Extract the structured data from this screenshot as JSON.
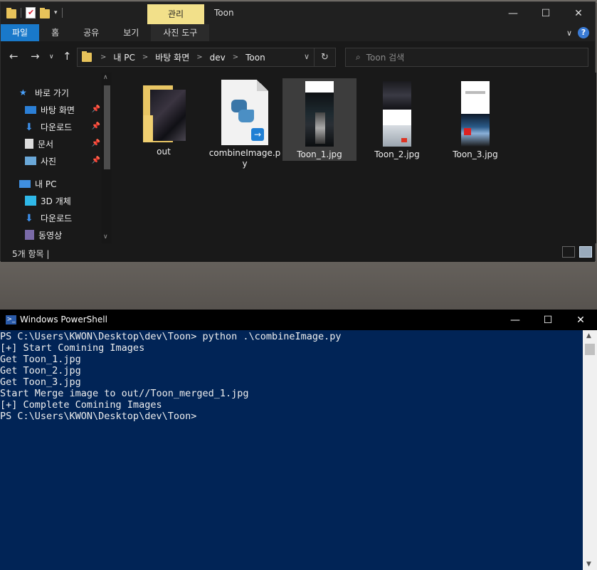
{
  "explorer": {
    "manage_tab": "관리",
    "window_title": "Toon",
    "ribbon_tabs": [
      "파일",
      "홈",
      "공유",
      "보기",
      "사진 도구"
    ],
    "breadcrumb": [
      "내 PC",
      "바탕 화면",
      "dev",
      "Toon"
    ],
    "search_placeholder": "Toon 검색",
    "sidebar": [
      {
        "label": "바로 가기",
        "icon": "star-icon",
        "pinned": false
      },
      {
        "label": "바탕 화면",
        "icon": "desktop-icon",
        "pinned": true
      },
      {
        "label": "다운로드",
        "icon": "download-icon",
        "pinned": true
      },
      {
        "label": "문서",
        "icon": "document-icon",
        "pinned": true
      },
      {
        "label": "사진",
        "icon": "pictures-icon",
        "pinned": true
      },
      {
        "label": "내 PC",
        "icon": "pc-icon",
        "pinned": false
      },
      {
        "label": "3D 개체",
        "icon": "cube-icon",
        "pinned": false
      },
      {
        "label": "다운로드",
        "icon": "download-icon",
        "pinned": false
      },
      {
        "label": "동영상",
        "icon": "video-icon",
        "pinned": false
      }
    ],
    "files": [
      {
        "name": "out",
        "type": "folder",
        "selected": false
      },
      {
        "name": "combineImage.py",
        "type": "python",
        "selected": false
      },
      {
        "name": "Toon_1.jpg",
        "type": "image",
        "selected": true
      },
      {
        "name": "Toon_2.jpg",
        "type": "image",
        "selected": false
      },
      {
        "name": "Toon_3.jpg",
        "type": "image",
        "selected": false
      }
    ],
    "status": "5개 항목  |"
  },
  "powershell": {
    "title": "Windows PowerShell",
    "lines": [
      "PS C:\\Users\\KWON\\Desktop\\dev\\Toon> python .\\combineImage.py",
      "[+] Start Comining Images",
      "Get Toon_1.jpg",
      "Get Toon_2.jpg",
      "Get Toon_3.jpg",
      "Start Merge image to out//Toon_merged_1.jpg",
      "[+] Complete Comining Images",
      "PS C:\\Users\\KWON\\Desktop\\dev\\Toon>"
    ]
  },
  "colors": {
    "file_tab": "#1979ca",
    "manage_tab": "#f2e08a",
    "ps_background": "#012456",
    "explorer_bg": "#191919"
  }
}
